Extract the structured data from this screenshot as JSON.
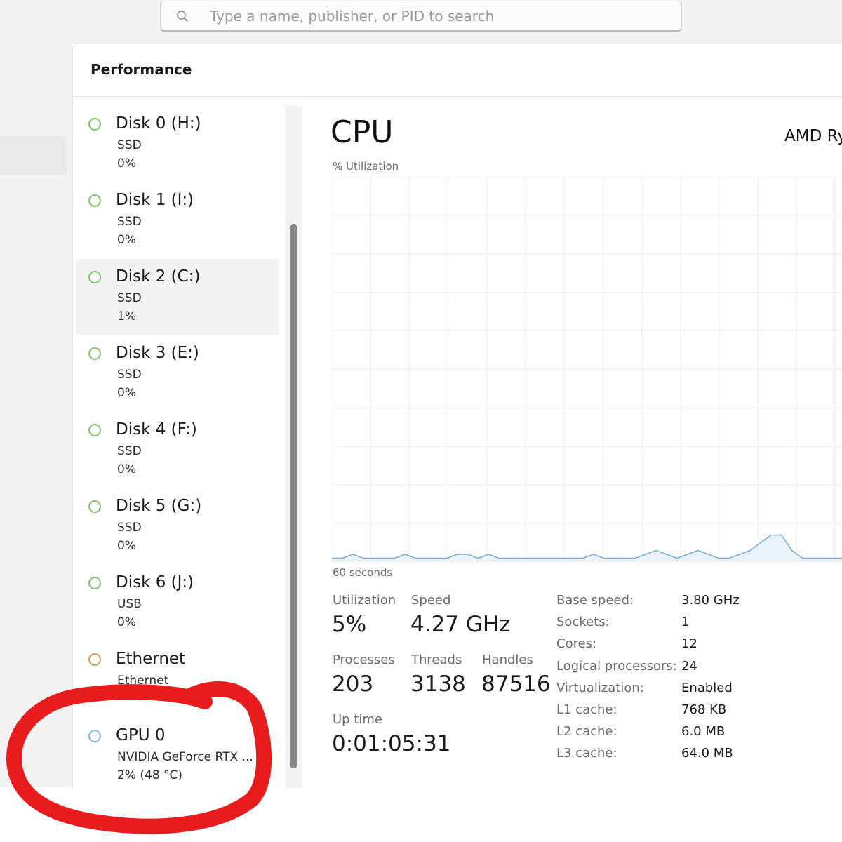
{
  "search": {
    "placeholder": "Type a name, publisher, or PID to search"
  },
  "section": {
    "title": "Performance"
  },
  "devices": [
    {
      "title": "Disk 0 (H:)",
      "sub": "SSD",
      "value": "0%",
      "status_color": "#7cc86a"
    },
    {
      "title": "Disk 1 (I:)",
      "sub": "SSD",
      "value": "0%",
      "status_color": "#7cc86a"
    },
    {
      "title": "Disk 2 (C:)",
      "sub": "SSD",
      "value": "1%",
      "status_color": "#7cc86a",
      "selected": true
    },
    {
      "title": "Disk 3 (E:)",
      "sub": "SSD",
      "value": "0%",
      "status_color": "#7cc86a"
    },
    {
      "title": "Disk 4 (F:)",
      "sub": "SSD",
      "value": "0%",
      "status_color": "#7cc86a"
    },
    {
      "title": "Disk 5 (G:)",
      "sub": "SSD",
      "value": "0%",
      "status_color": "#7cc86a"
    },
    {
      "title": "Disk 6 (J:)",
      "sub": "USB",
      "value": "0%",
      "status_color": "#7cc86a"
    },
    {
      "title": "Ethernet",
      "sub": "Ethernet",
      "value": "",
      "status_color": "#d99a60"
    },
    {
      "title": "GPU 0",
      "sub": "NVIDIA GeForce RTX ...",
      "value": "2%  (48 °C)",
      "status_color": "#8ab8de"
    }
  ],
  "cpu": {
    "title": "CPU",
    "model": "AMD Ry",
    "graph_label": "% Utilization",
    "time_label": "60 seconds",
    "line_color": "#7aaed6",
    "utilization_history": [
      1,
      1,
      2,
      1,
      1,
      1,
      1,
      2,
      1,
      1,
      1,
      1,
      2,
      2,
      1,
      2,
      1,
      1,
      1,
      1,
      1,
      1,
      1,
      1,
      1,
      2,
      1,
      1,
      1,
      1,
      2,
      3,
      2,
      1,
      2,
      3,
      2,
      1,
      1,
      2,
      3,
      5,
      7,
      7,
      3,
      1,
      1,
      1,
      1,
      1,
      1,
      1
    ]
  },
  "stats": {
    "utilization": {
      "label": "Utilization",
      "value": "5%"
    },
    "speed": {
      "label": "Speed",
      "value": "4.27 GHz"
    },
    "processes": {
      "label": "Processes",
      "value": "203"
    },
    "threads": {
      "label": "Threads",
      "value": "3138"
    },
    "handles": {
      "label": "Handles",
      "value": "87516"
    },
    "uptime": {
      "label": "Up time",
      "value": "0:01:05:31"
    }
  },
  "specs": [
    {
      "label": "Base speed:",
      "value": "3.80 GHz"
    },
    {
      "label": "Sockets:",
      "value": "1"
    },
    {
      "label": "Cores:",
      "value": "12"
    },
    {
      "label": "Logical processors:",
      "value": "24"
    },
    {
      "label": "Virtualization:",
      "value": "Enabled"
    },
    {
      "label": "L1 cache:",
      "value": "768 KB"
    },
    {
      "label": "L2 cache:",
      "value": "6.0 MB"
    },
    {
      "label": "L3 cache:",
      "value": "64.0 MB"
    }
  ],
  "annotation": {
    "color": "#e81c1c",
    "target": "GPU 0"
  }
}
